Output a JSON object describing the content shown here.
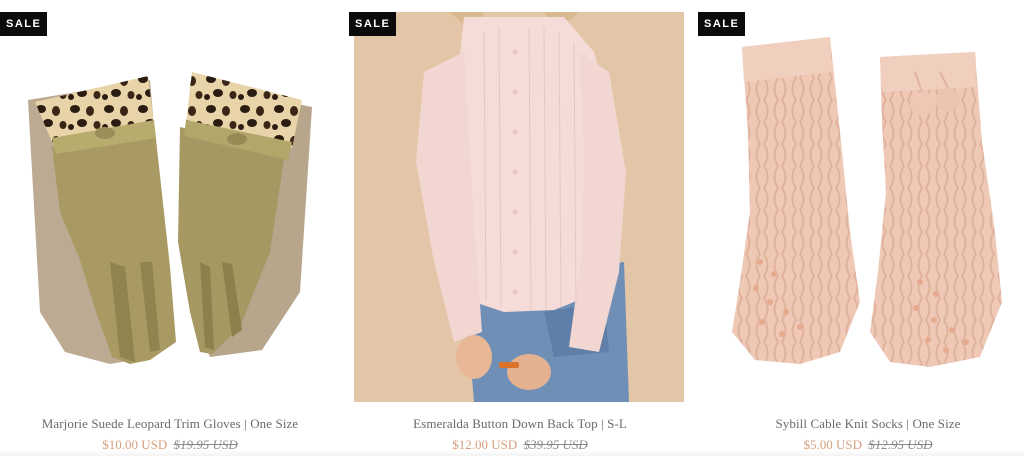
{
  "products": [
    {
      "badge": "SALE",
      "title": "Marjorie Suede Leopard Trim Gloves | One Size",
      "price": "$10.00 USD",
      "compare_price": "$19.95 USD",
      "image_icon": "gloves-product-image"
    },
    {
      "badge": "SALE",
      "title": "Esmeralda Button Down Back Top | S-L",
      "price": "$12.00 USD",
      "compare_price": "$39.95 USD",
      "image_icon": "sweater-product-image"
    },
    {
      "badge": "SALE",
      "title": "Sybill Cable Knit Socks | One Size",
      "price": "$5.00 USD",
      "compare_price": "$12.95 USD",
      "image_icon": "socks-product-image"
    }
  ],
  "colors": {
    "sale_price": "#d6a07e",
    "badge_bg": "#0b0b0b",
    "title_text": "#6a6a6a"
  }
}
